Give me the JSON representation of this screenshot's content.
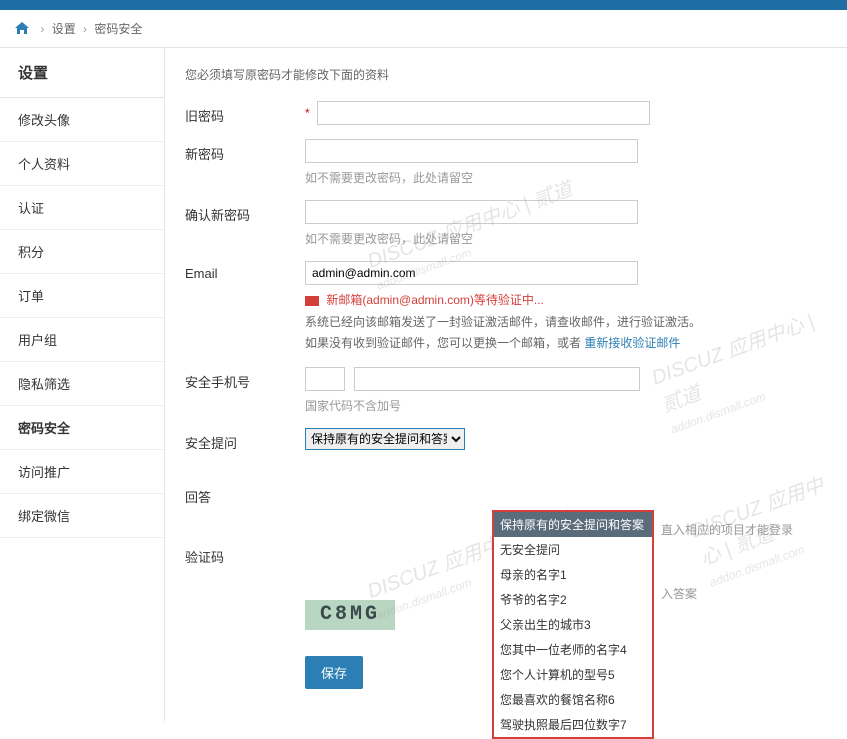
{
  "breadcrumb": {
    "item1": "设置",
    "item2": "密码安全"
  },
  "sidebar": {
    "title": "设置",
    "items": [
      {
        "label": "修改头像"
      },
      {
        "label": "个人资料"
      },
      {
        "label": "认证"
      },
      {
        "label": "积分"
      },
      {
        "label": "订单"
      },
      {
        "label": "用户组"
      },
      {
        "label": "隐私筛选"
      },
      {
        "label": "密码安全"
      },
      {
        "label": "访问推广"
      },
      {
        "label": "绑定微信"
      }
    ]
  },
  "main": {
    "hint": "您必须填写原密码才能修改下面的资料",
    "labels": {
      "old_password": "旧密码",
      "new_password": "新密码",
      "confirm_password": "确认新密码",
      "email": "Email",
      "phone": "安全手机号",
      "question": "安全提问",
      "answer": "回答",
      "captcha": "验证码"
    },
    "hints": {
      "new_pw": "如不需要更改密码，此处请留空",
      "confirm_pw": "如不需要更改密码，此处请留空",
      "phone": "国家代码不含加号",
      "question_side": "直入相应的项目才能登录",
      "answer_side": "入答案"
    },
    "email_value": "admin@admin.com",
    "email_verify": {
      "text": "新邮箱(admin@admin.com)等待验证中...",
      "desc1": "系统已经向该邮箱发送了一封验证激活邮件，请查收邮件，进行验证激活。",
      "desc2_prefix": "如果没有收到验证邮件，您可以更换一个邮箱，或者 ",
      "desc2_link": "重新接收验证邮件"
    },
    "question_options": [
      "保持原有的安全提问和答案",
      "无安全提问",
      "母亲的名字1",
      "爷爷的名字2",
      "父亲出生的城市3",
      "您其中一位老师的名字4",
      "您个人计算机的型号5",
      "您最喜欢的餐馆名称6",
      "驾驶执照最后四位数字7"
    ],
    "question_selected": "保持原有的安全提问和答案",
    "captcha_value": "C8MG",
    "save_label": "保存"
  },
  "watermark": {
    "text_main": "DISCUZ",
    "text_sub": "应用中心 | 贰道",
    "text_url": "addon.dismall.com"
  }
}
